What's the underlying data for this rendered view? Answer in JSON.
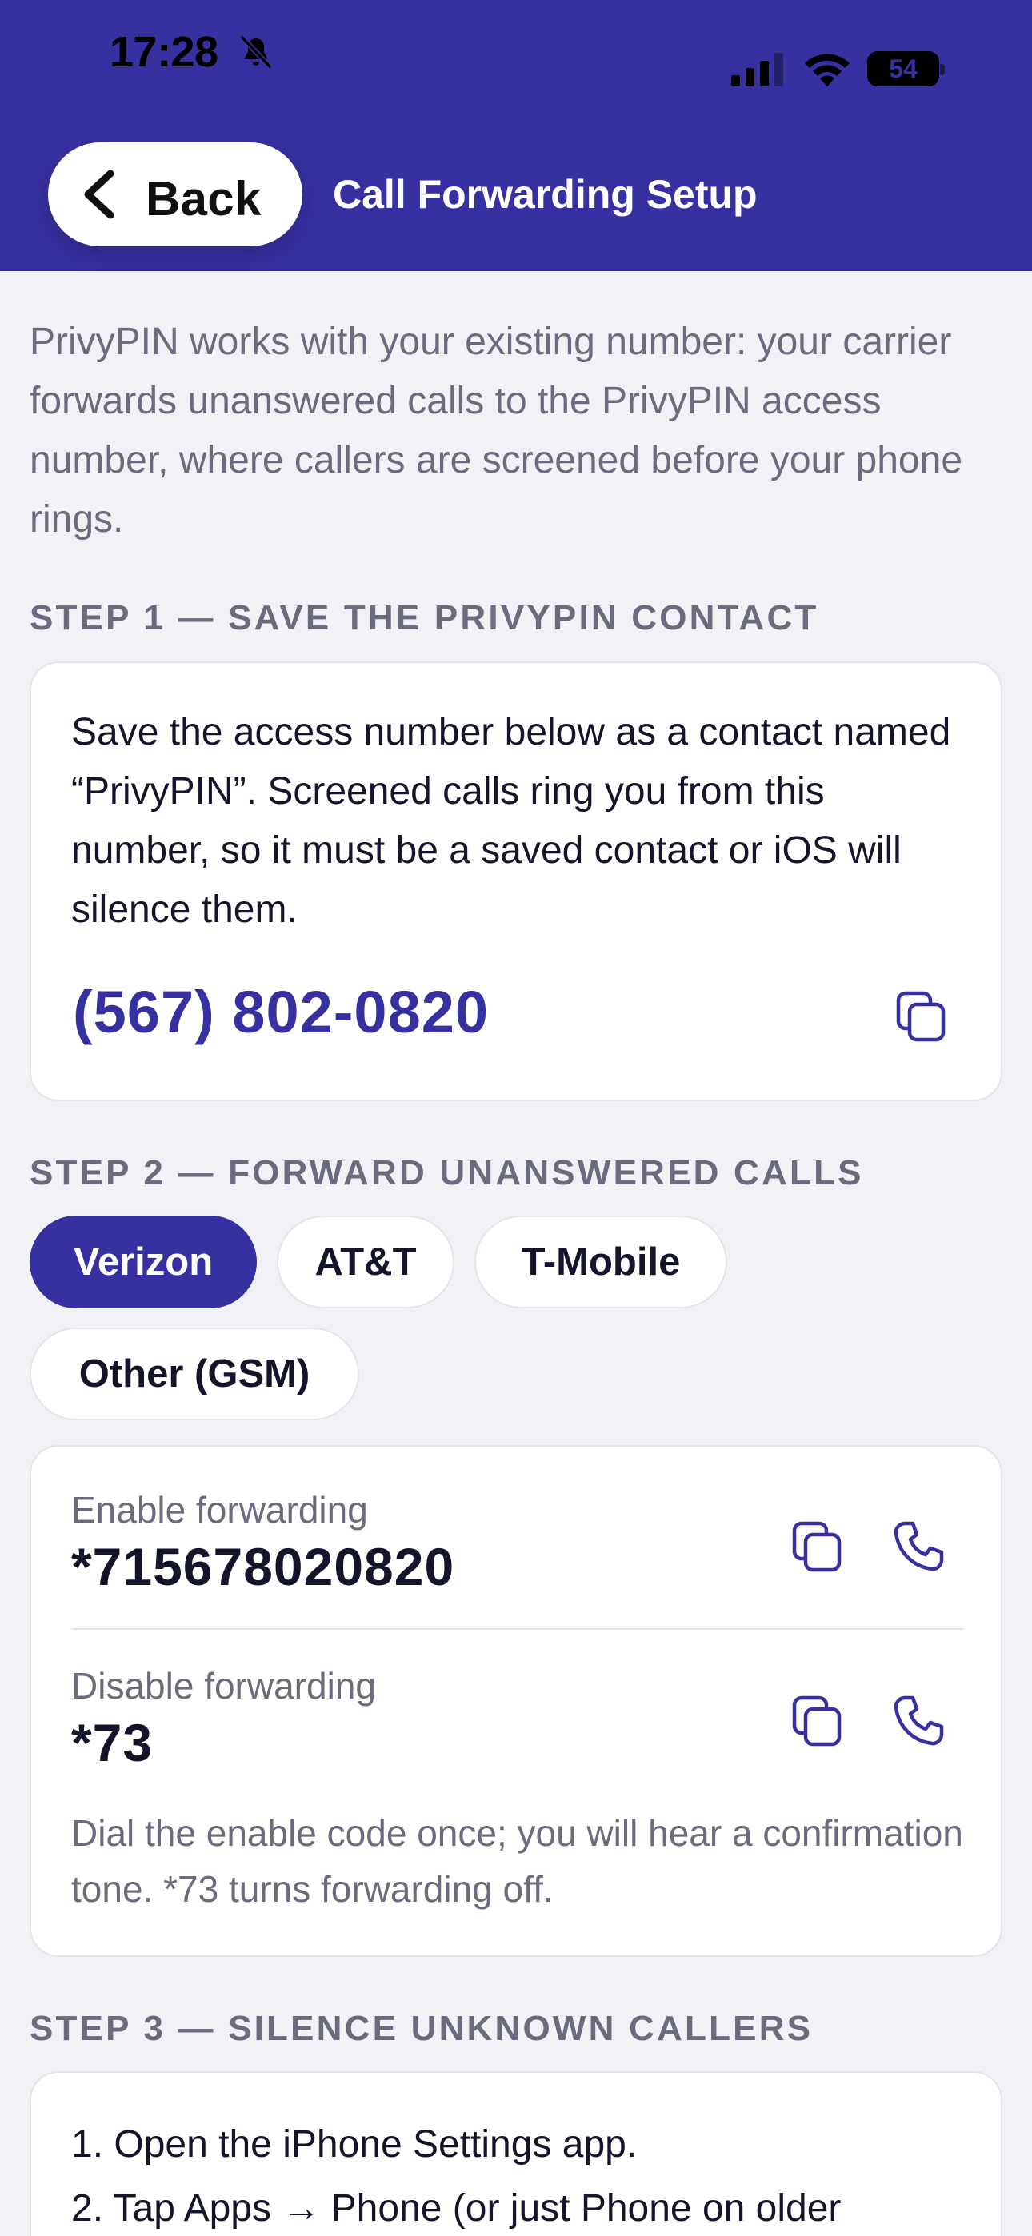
{
  "status_bar": {
    "time": "17:28",
    "battery": "54",
    "battery_fraction": 0.54
  },
  "header": {
    "back_label": "Back",
    "title": "Call Forwarding Setup",
    "background_color": "#3730a0"
  },
  "intro": "PrivyPIN works with your existing number: your carrier forwards unanswered calls to the PrivyPIN access number, where callers are screened before your phone rings.",
  "step1": {
    "heading": "STEP 1 — SAVE THE PRIVYPIN CONTACT",
    "body": "Save the access number below as a contact named “PrivyPIN”. Screened calls ring you from this number, so it must be a saved contact or iOS will silence them.",
    "access_number": "(567) 802-0820",
    "copy_icon": "copy-icon"
  },
  "step2": {
    "heading": "STEP 2 — FORWARD UNANSWERED CALLS",
    "carriers": [
      "Verizon",
      "AT&T",
      "T-Mobile",
      "Other (GSM)"
    ],
    "selected_carrier": "Verizon",
    "enable_label": "Enable forwarding",
    "enable_code": "*715678020820",
    "disable_label": "Disable forwarding",
    "disable_code": "*73",
    "note": "Dial the enable code once; you will hear a confirmation tone. *73 turns forwarding off."
  },
  "step3": {
    "heading": "STEP 3 — SILENCE UNKNOWN CALLERS",
    "items": [
      "1. Open the iPhone Settings app.",
      "2. Tap Apps → Phone (or just Phone on older"
    ]
  },
  "colors": {
    "accent": "#3730a0",
    "background": "#f2f2f6",
    "muted_text": "#6b6b7e"
  }
}
